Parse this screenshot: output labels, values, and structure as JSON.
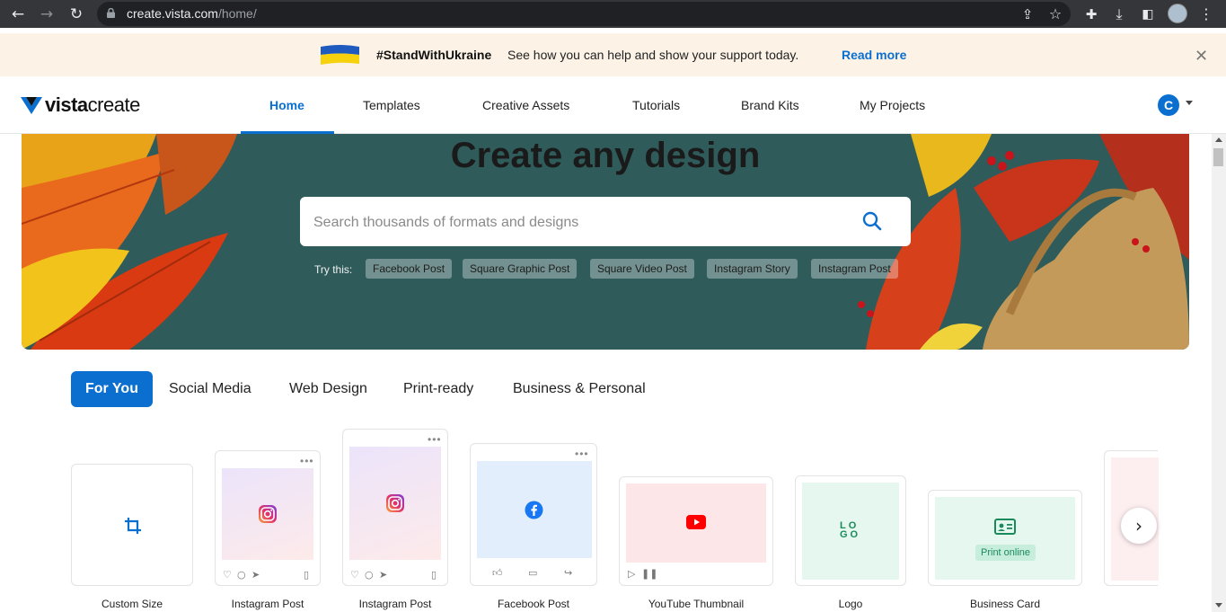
{
  "browser": {
    "url_host": "create.vista.com",
    "url_path": "/home/"
  },
  "banner": {
    "hashtag": "#StandWithUkraine",
    "message": "See how you can help and show your support today.",
    "link": "Read more",
    "flag_colors": [
      "#1f5bbf",
      "#f5d20d"
    ]
  },
  "header": {
    "logo_bold": "vista",
    "logo_thin": "create",
    "nav": [
      {
        "label": "Home",
        "active": true
      },
      {
        "label": "Templates"
      },
      {
        "label": "Creative Assets"
      },
      {
        "label": "Tutorials"
      },
      {
        "label": "Brand Kits"
      },
      {
        "label": "My Projects"
      }
    ],
    "user_initial": "C"
  },
  "hero": {
    "title": "Create any design",
    "search_placeholder": "Search thousands of formats and designs",
    "try_label": "Try this:",
    "chips": [
      "Facebook Post",
      "Square Graphic Post",
      "Square Video Post",
      "Instagram Story",
      "Instagram Post"
    ]
  },
  "categories": [
    "For You",
    "Social Media",
    "Web Design",
    "Print-ready",
    "Business & Personal"
  ],
  "formats": [
    {
      "label": "Custom Size",
      "icon": "crop-icon"
    },
    {
      "label": "Instagram Post",
      "icon": "instagram-icon"
    },
    {
      "label": "Instagram Post",
      "icon": "instagram-icon"
    },
    {
      "label": "Facebook Post",
      "icon": "facebook-icon"
    },
    {
      "label": "YouTube Thumbnail",
      "icon": "youtube-icon"
    },
    {
      "label": "Logo",
      "icon": "logo-letters",
      "letters": "LOGO"
    },
    {
      "label": "Business Card",
      "icon": "id-card-icon",
      "pill": "Print online"
    }
  ],
  "colors": {
    "accent": "#0b6fd0",
    "hero_bg": "#2f5c5a"
  }
}
